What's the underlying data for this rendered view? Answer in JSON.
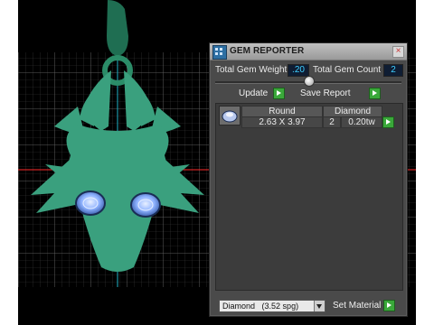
{
  "panel": {
    "title": "GEM REPORTER",
    "close_glyph": "×",
    "total_gem_weight_label": "Total Gem Weight",
    "total_gem_weight_value": ".20",
    "total_gem_count_label": "Total Gem Count",
    "total_gem_count_value": "2",
    "update_label": "Update",
    "save_report_label": "Save Report",
    "table": {
      "shape_header": "Round",
      "material_header": "Diamond",
      "size": "2.63 X 3.97",
      "count": "2",
      "weight": "0.20tw"
    },
    "material_select_value": "Diamond",
    "material_select_spg": "(3.52 spg)",
    "set_material_label": "Set Material"
  },
  "colors": {
    "pendant": "#3aa07e",
    "gem": "#8fb3ff",
    "accent_play": "#3aa83a",
    "value_text": "#3fd0ff"
  },
  "icons": {
    "title": "gem-reporter-icon",
    "close": "close-icon",
    "update": "play-arrow-icon",
    "save": "play-arrow-icon",
    "set_material": "play-arrow-icon",
    "dropdown": "chevron-down-icon",
    "gem_thumb": "round-gem-icon"
  }
}
